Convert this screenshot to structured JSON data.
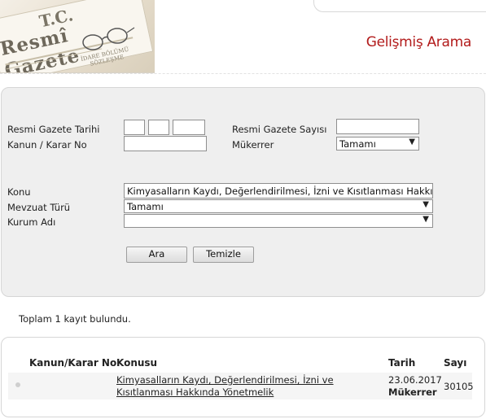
{
  "header": {
    "banner": {
      "tc": "T.C.",
      "resmi_gazete": "Resmî Gazete",
      "idare": "İDARE BÖLÜMÜ",
      "sozlesme": "SÖZLEŞME"
    },
    "title": "Gelişmiş Arama"
  },
  "search_form": {
    "labels": {
      "gazete_tarihi": "Resmi Gazete Tarihi",
      "kanun_karar_no": "Kanun / Karar No",
      "gazete_sayisi": "Resmi Gazete Sayısı",
      "mukerrer": "Mükerrer",
      "konu": "Konu",
      "mevzuat_turu": "Mevzuat Türü",
      "kurum_adi": "Kurum Adı"
    },
    "values": {
      "date_day": "",
      "date_month": "",
      "date_year": "",
      "kanun_karar_no": "",
      "gazete_sayisi": "",
      "mukerrer": "Tamamı",
      "konu": "Kimyasalların Kaydı, Değerlendirilmesi, İzni ve Kısıtlanması Hakkında Yö",
      "mevzuat_turu": "Tamamı",
      "kurum_adi": ""
    },
    "buttons": {
      "search": "Ara",
      "clear": "Temizle"
    }
  },
  "result_count": "Toplam 1 kayıt bulundu.",
  "results": {
    "columns": [
      "Kanun/Karar No",
      "Konusu",
      "Tarih",
      "Sayı"
    ],
    "rows": [
      {
        "kanun_karar_no": "",
        "konusu": "Kimyasalların Kaydı, Değerlendirilmesi, İzni ve Kısıtlanması Hakkında Yönetmelik",
        "tarih": "23.06.2017",
        "tarih_note": "Mükerrer",
        "sayi": "30105"
      }
    ]
  },
  "colors": {
    "title": "#b21b1b",
    "panel_bg": "#efefef"
  }
}
